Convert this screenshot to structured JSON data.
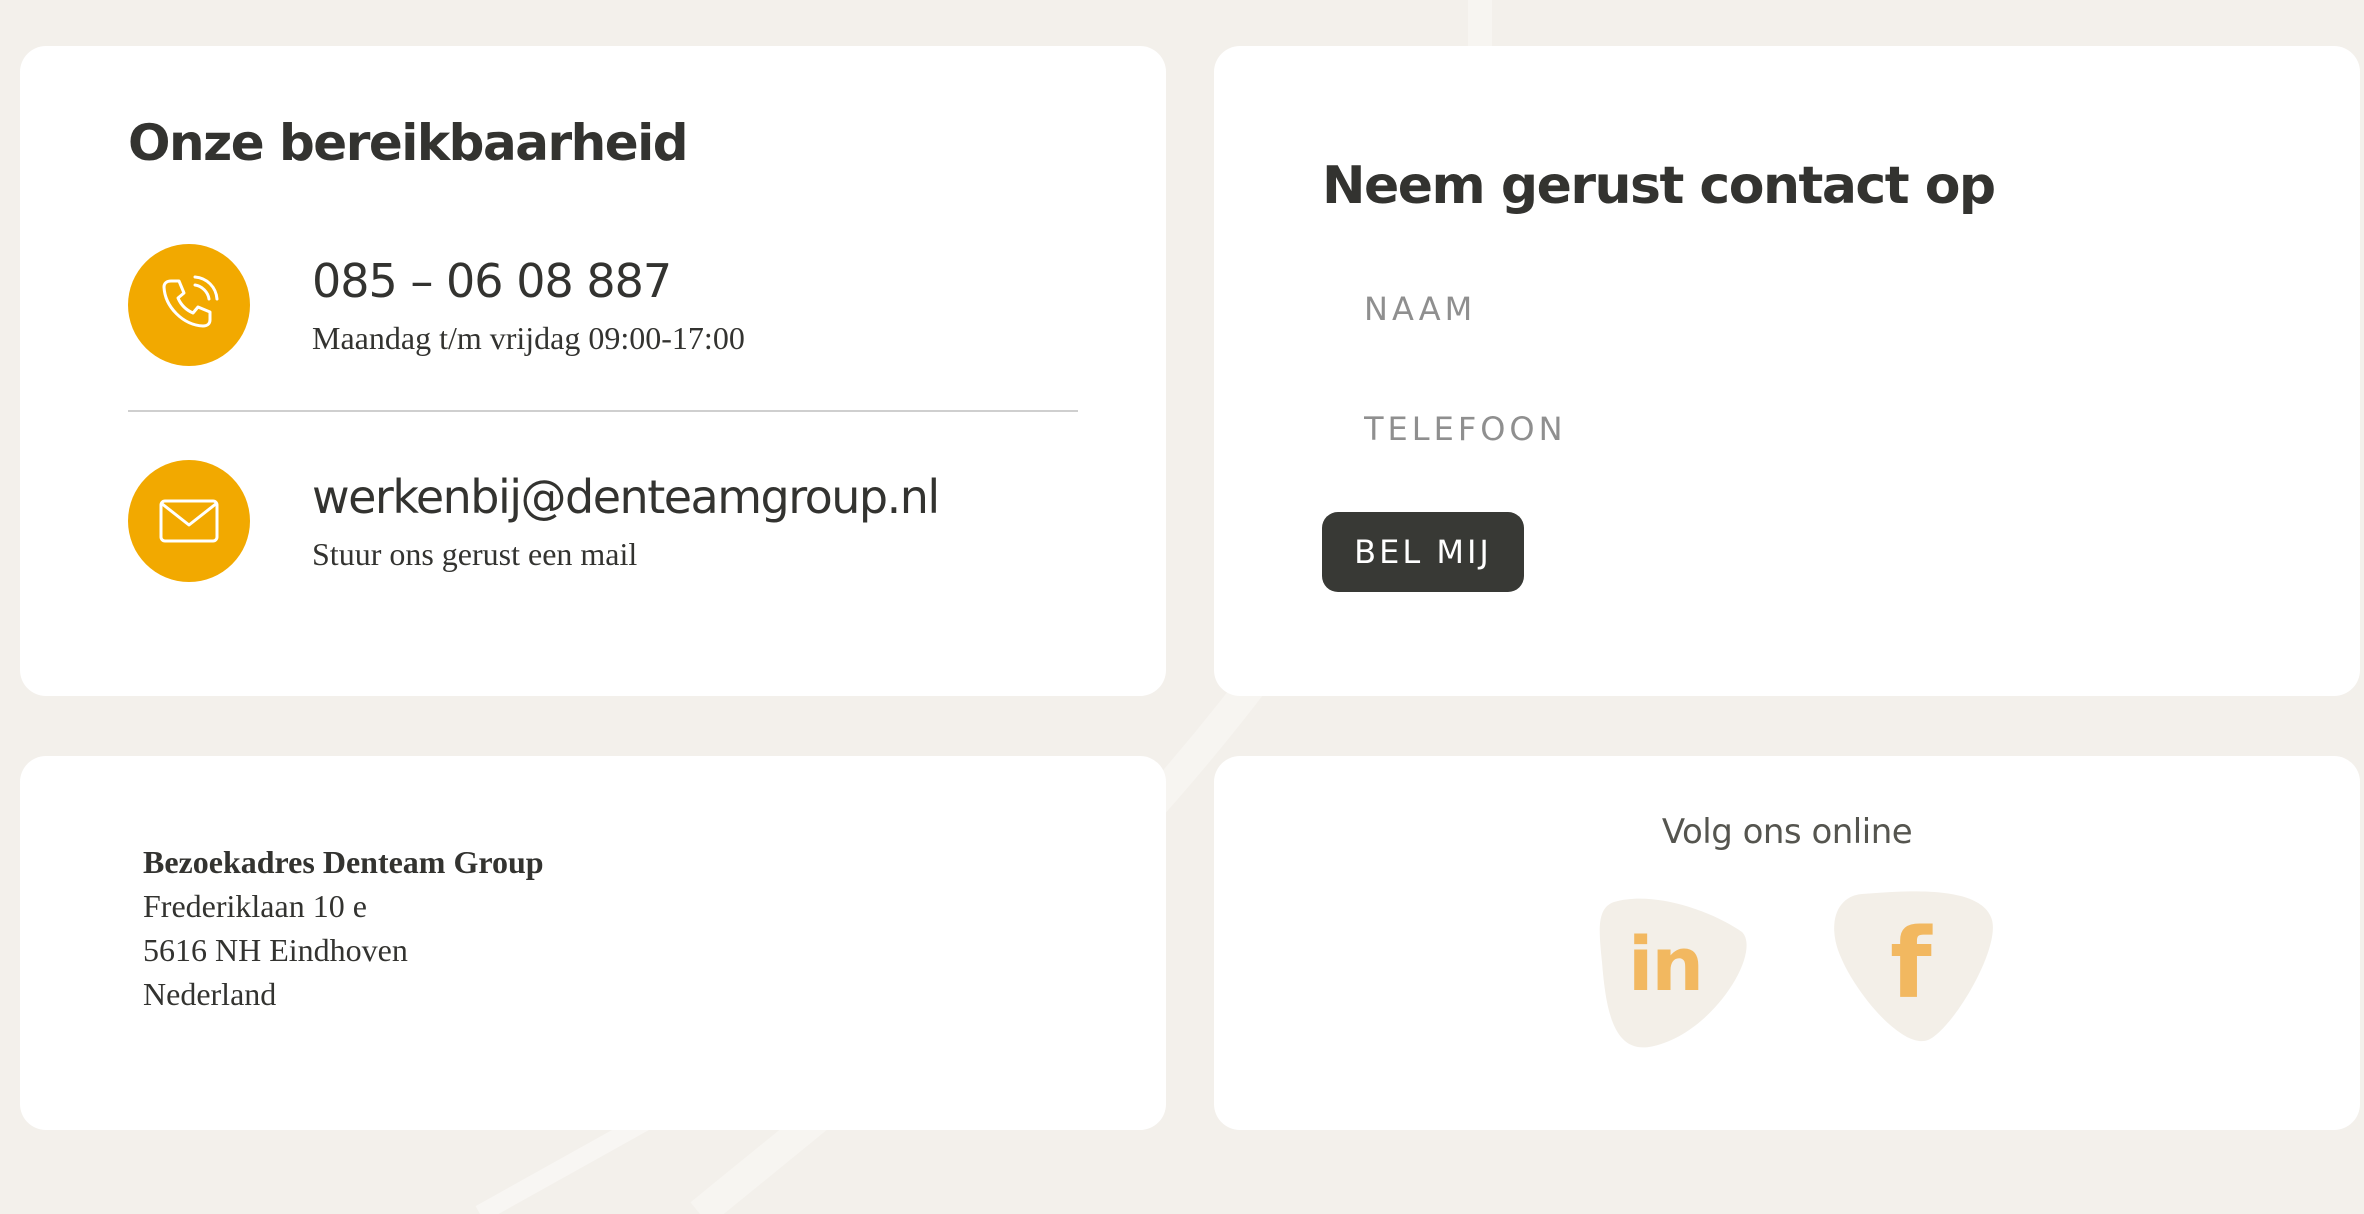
{
  "reach": {
    "title": "Onze bereikbaarheid",
    "phone": {
      "icon": "phone-icon",
      "number": "085 – 06 08 887",
      "hours": "Maandag t/m vrijdag 09:00-17:00"
    },
    "email": {
      "icon": "mail-icon",
      "address": "werkenbij@denteamgroup.nl",
      "note": "Stuur ons gerust een mail"
    }
  },
  "contact": {
    "title": "Neem gerust contact op",
    "name_placeholder": "NAAM",
    "phone_placeholder": "TELEFOON",
    "name_value": "",
    "phone_value": "",
    "button_label": "BEL MIJ"
  },
  "address": {
    "heading": "Bezoekadres Denteam Group",
    "street": "Frederiklaan 10 e",
    "city": "5616 NH Eindhoven",
    "country": "Nederland"
  },
  "social": {
    "title": "Volg ons online",
    "linkedin_label": "in",
    "facebook_label": "f",
    "linkedin_icon": "linkedin-icon",
    "facebook_icon": "facebook-icon"
  },
  "colors": {
    "accent": "#f2a900",
    "social_accent": "#f2b860",
    "background": "#f3f0eb",
    "button": "#383935",
    "text": "#333330"
  }
}
